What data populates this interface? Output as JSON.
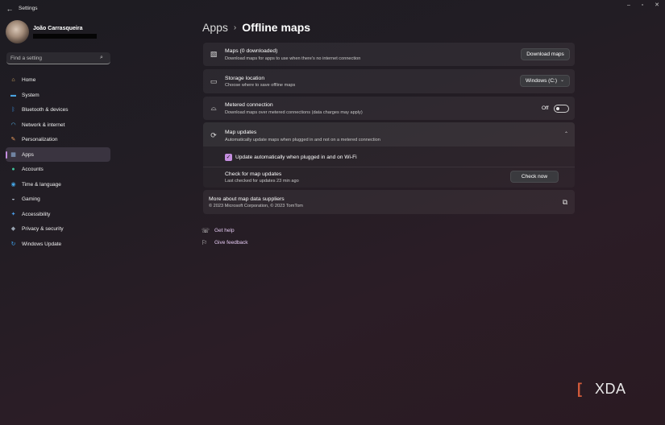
{
  "window": {
    "title": "Settings",
    "back_glyph": "←",
    "minimize_glyph": "–",
    "maximize_glyph": "▫",
    "close_glyph": "✕"
  },
  "profile": {
    "name": "João Carrasqueira"
  },
  "search": {
    "placeholder": "Find a setting",
    "icon": "⌕"
  },
  "sidebar": {
    "items": [
      {
        "label": "Home",
        "icon": "home-icon",
        "glyph": "⌂",
        "color": "#e8b86b"
      },
      {
        "label": "System",
        "icon": "system-icon",
        "glyph": "▬",
        "color": "#4aa3e0"
      },
      {
        "label": "Bluetooth & devices",
        "icon": "bluetooth-icon",
        "glyph": "ᛒ",
        "color": "#3b8fe0"
      },
      {
        "label": "Network & internet",
        "icon": "wifi-icon",
        "glyph": "◠",
        "color": "#58b7f0"
      },
      {
        "label": "Personalization",
        "icon": "brush-icon",
        "glyph": "✎",
        "color": "#e89a5c"
      },
      {
        "label": "Apps",
        "icon": "apps-icon",
        "glyph": "▦",
        "color": "#8fb0d8",
        "selected": true
      },
      {
        "label": "Accounts",
        "icon": "accounts-icon",
        "glyph": "●",
        "color": "#3fc39a"
      },
      {
        "label": "Time & language",
        "icon": "globe-icon",
        "glyph": "◉",
        "color": "#45a6e6"
      },
      {
        "label": "Gaming",
        "icon": "gamepad-icon",
        "glyph": "◒",
        "color": "#aab4c2"
      },
      {
        "label": "Accessibility",
        "icon": "accessibility-icon",
        "glyph": "✦",
        "color": "#4a9de8"
      },
      {
        "label": "Privacy & security",
        "icon": "shield-icon",
        "glyph": "◆",
        "color": "#98a3b0"
      },
      {
        "label": "Windows Update",
        "icon": "update-icon",
        "glyph": "↻",
        "color": "#3da0ea"
      }
    ],
    "accent": "#c58ee0"
  },
  "breadcrumb": {
    "parent": "Apps",
    "separator": "›",
    "current": "Offline maps"
  },
  "maps": {
    "title": "Maps (0 downloaded)",
    "subtitle": "Download maps for apps to use when there's no internet connection",
    "button": "Download maps",
    "icon_glyph": "▧"
  },
  "storage": {
    "title": "Storage location",
    "subtitle": "Choose where to save offline maps",
    "value": "Windows (C:)",
    "chevron": "⌄",
    "icon_glyph": "▭"
  },
  "metered": {
    "title": "Metered connection",
    "subtitle": "Download maps over metered connections (data charges may apply)",
    "state_label": "Off",
    "icon_glyph": "⌓"
  },
  "map_updates": {
    "title": "Map updates",
    "subtitle": "Automatically update maps when plugged in and not on a metered connection",
    "chevron": "⌃",
    "icon_glyph": "⟳",
    "auto_update_label": "Update automatically when plugged in and on Wi-Fi",
    "auto_update_checked": true,
    "check_mark": "✓",
    "check_title": "Check for map updates",
    "check_sub": "Last checked for updates 23 min ago",
    "check_button": "Check now"
  },
  "suppliers": {
    "title": "More about map data suppliers",
    "subtitle": "© 2023 Microsoft Corporation, © 2023 TomTom",
    "icon_glyph": "⧉"
  },
  "links": [
    {
      "label": "Get help",
      "icon": "help-icon",
      "glyph": "☏"
    },
    {
      "label": "Give feedback",
      "icon": "feedback-icon",
      "glyph": "⚐"
    }
  ],
  "watermark": {
    "bracket": "[",
    "text": "XDA"
  }
}
